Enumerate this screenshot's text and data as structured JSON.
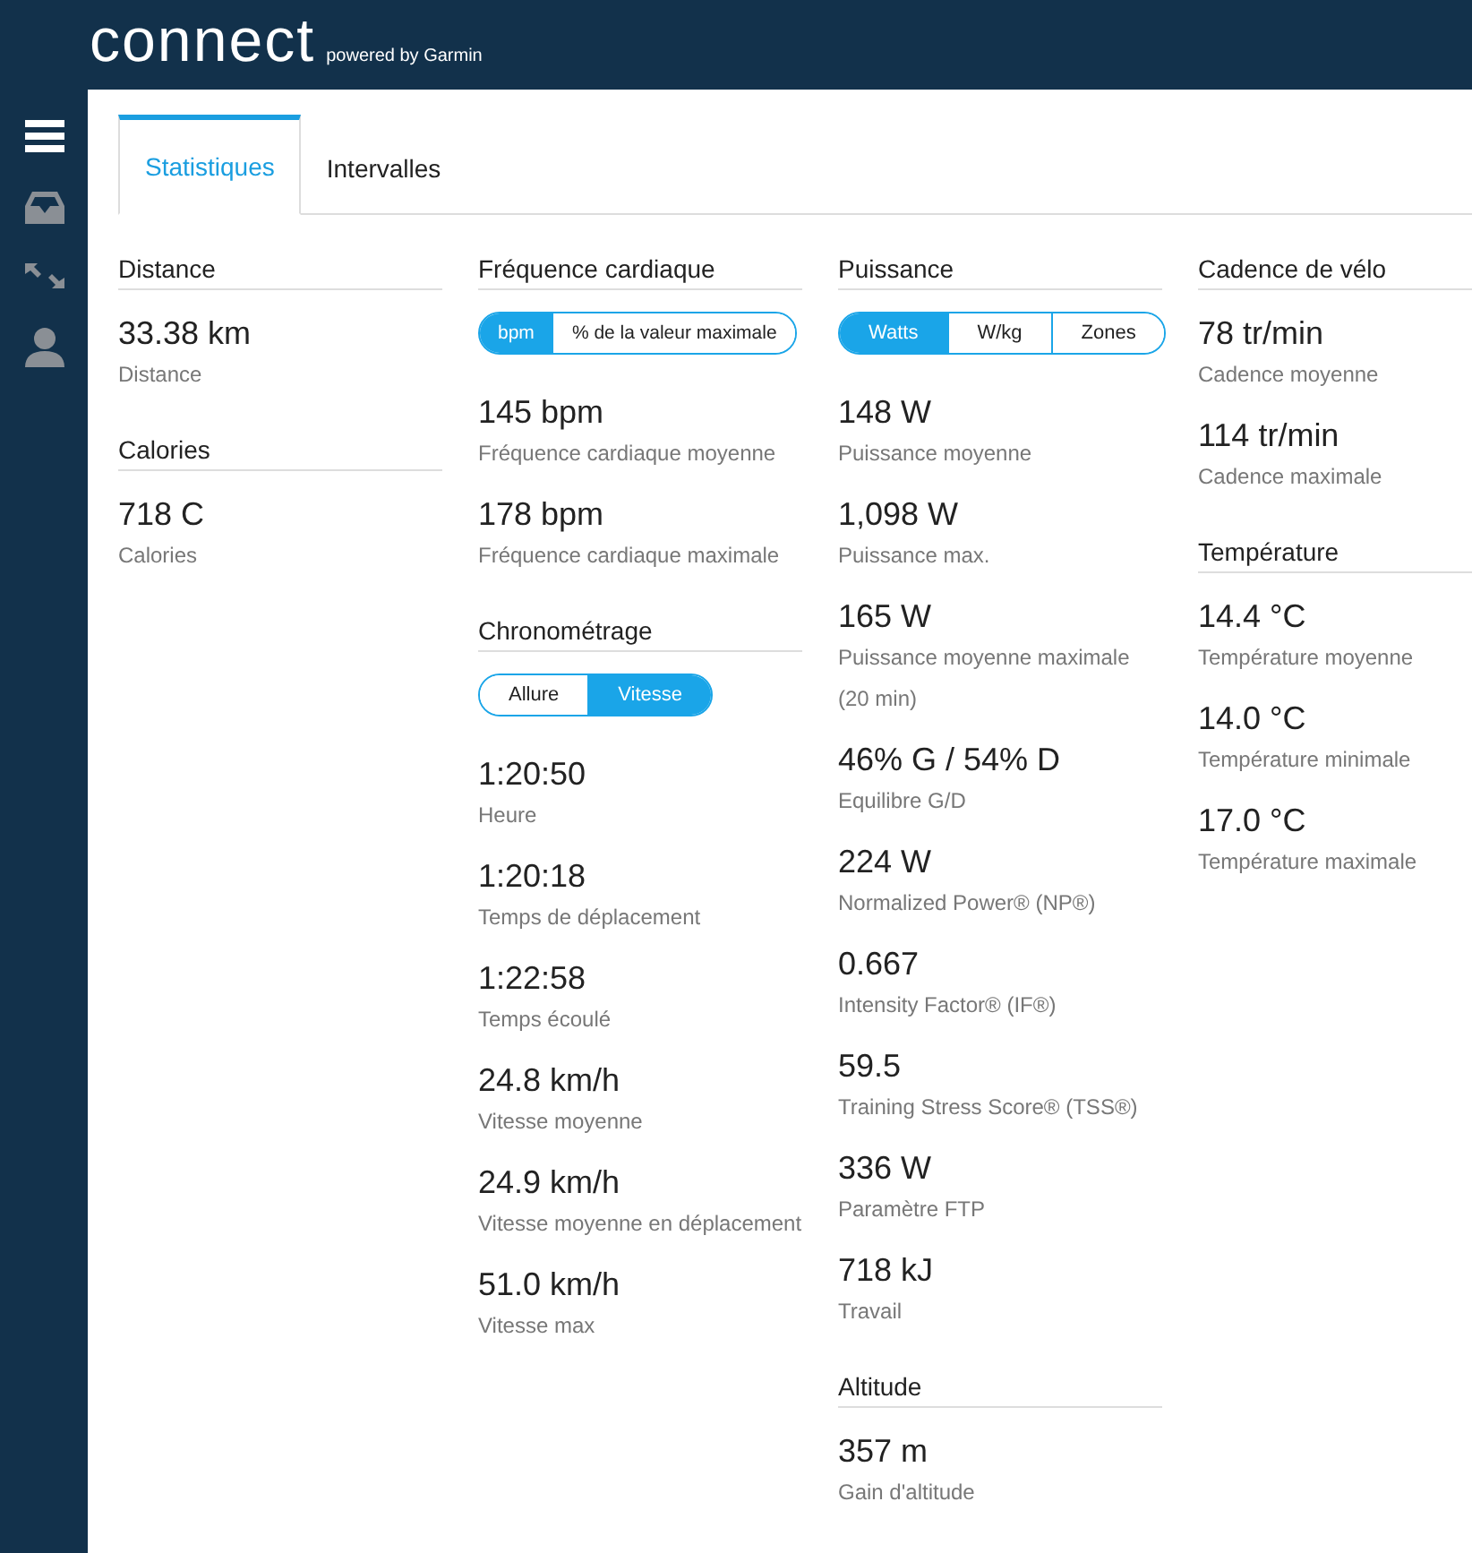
{
  "header": {
    "logo": "connect",
    "tagline": "powered by Garmin"
  },
  "sidebar": {
    "items": [
      {
        "kind": "menu"
      },
      {
        "kind": "inbox"
      },
      {
        "kind": "arrows"
      },
      {
        "kind": "person"
      }
    ]
  },
  "tabs": [
    {
      "label": "Statistiques",
      "selected": true
    },
    {
      "label": "Intervalles",
      "selected": false
    }
  ],
  "columns": [
    [
      {
        "title": "Distance",
        "stats": [
          {
            "value": "33.38 km",
            "label": "Distance"
          }
        ]
      },
      {
        "title": "Calories",
        "stats": [
          {
            "value": "718 C",
            "label": "Calories"
          }
        ]
      }
    ],
    [
      {
        "title": "Fréquence cardiaque",
        "toggle": [
          {
            "label": "bpm",
            "selected": true
          },
          {
            "label": "% de la valeur maximale",
            "selected": false
          }
        ],
        "stats": [
          {
            "value": "145 bpm",
            "label": "Fréquence cardiaque moyenne"
          },
          {
            "value": "178 bpm",
            "label": "Fréquence cardiaque maximale"
          }
        ]
      },
      {
        "title": "Chronométrage",
        "toggle": [
          {
            "label": "Allure",
            "selected": false
          },
          {
            "label": "Vitesse",
            "selected": true
          }
        ],
        "stats": [
          {
            "value": "1:20:50",
            "label": "Heure"
          },
          {
            "value": "1:20:18",
            "label": "Temps de déplacement"
          },
          {
            "value": "1:22:58",
            "label": "Temps écoulé"
          },
          {
            "value": "24.8 km/h",
            "label": "Vitesse moyenne"
          },
          {
            "value": "24.9 km/h",
            "label": "Vitesse moyenne en déplacement"
          },
          {
            "value": "51.0 km/h",
            "label": "Vitesse max"
          }
        ]
      }
    ],
    [
      {
        "title": "Puissance",
        "toggle": [
          {
            "label": "Watts",
            "selected": true
          },
          {
            "label": "W/kg",
            "selected": false
          },
          {
            "label": "Zones",
            "selected": false
          }
        ],
        "stats": [
          {
            "value": "148 W",
            "label": "Puissance moyenne"
          },
          {
            "value": "1,098 W",
            "label": "Puissance max."
          },
          {
            "value": "165 W",
            "label": "Puissance moyenne maximale (20 min)"
          },
          {
            "value": "46% G / 54% D",
            "label": "Equilibre G/D"
          },
          {
            "value": "224 W",
            "label": "Normalized Power® (NP®)"
          },
          {
            "value": "0.667",
            "label": "Intensity Factor® (IF®)"
          },
          {
            "value": "59.5",
            "label": "Training Stress Score® (TSS®)"
          },
          {
            "value": "336 W",
            "label": "Paramètre FTP"
          },
          {
            "value": "718 kJ",
            "label": "Travail"
          }
        ]
      },
      {
        "title": "Altitude",
        "stats": [
          {
            "value": "357 m",
            "label": "Gain d'altitude"
          }
        ]
      }
    ],
    [
      {
        "title": "Cadence de vélo",
        "stats": [
          {
            "value": "78 tr/min",
            "label": "Cadence moyenne"
          },
          {
            "value": "114 tr/min",
            "label": "Cadence maximale"
          }
        ]
      },
      {
        "title": "Température",
        "stats": [
          {
            "value": "14.4 °C",
            "label": "Température moyenne"
          },
          {
            "value": "14.0 °C",
            "label": "Température minimale"
          },
          {
            "value": "17.0 °C",
            "label": "Température maximale"
          }
        ]
      }
    ]
  ]
}
